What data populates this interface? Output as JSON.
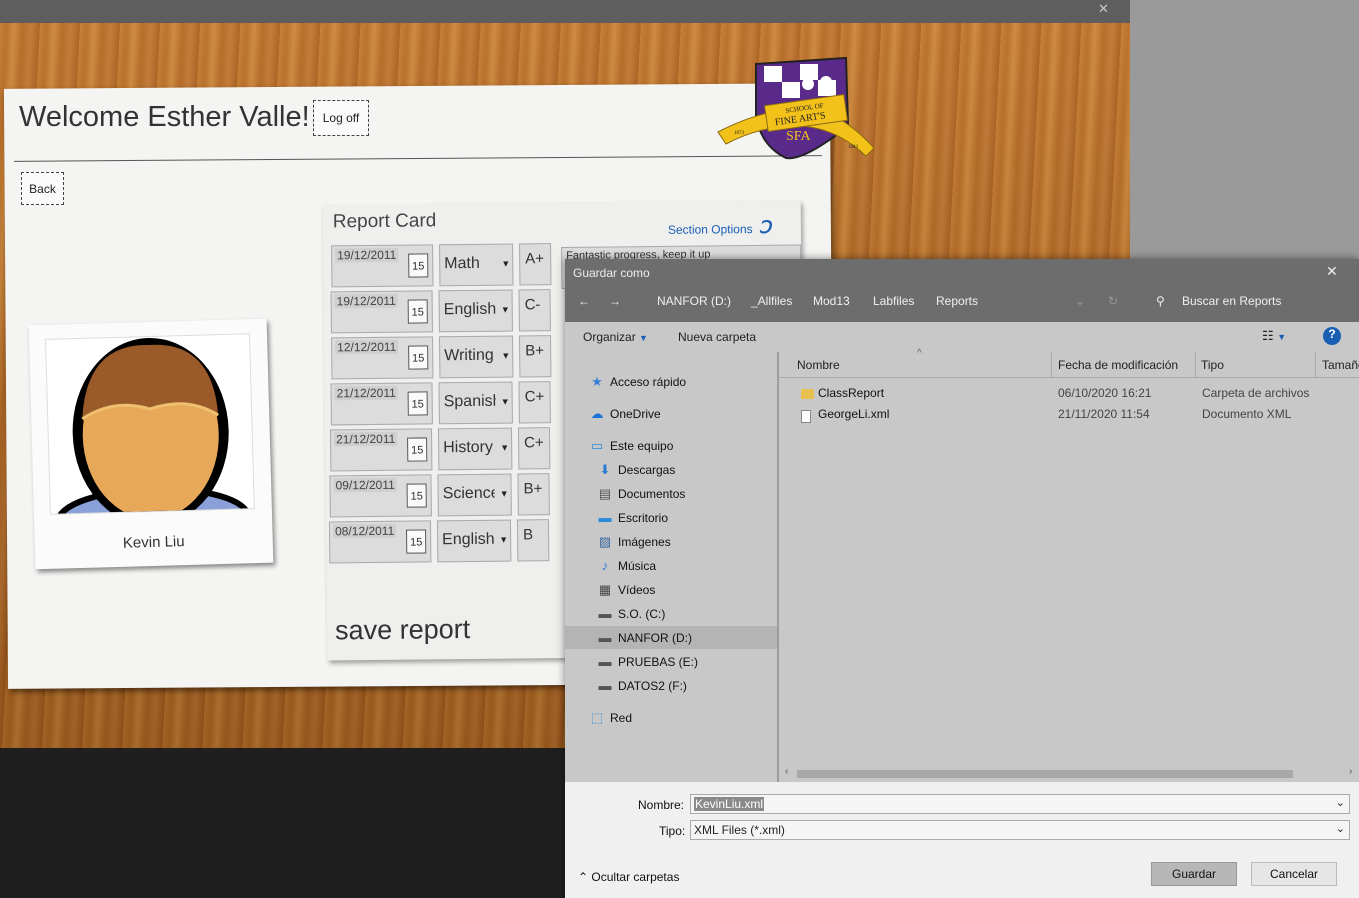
{
  "app": {
    "close_glyph": "✕",
    "welcome": "Welcome Esther Valle!",
    "logoff_label": "Log off",
    "back_label": "Back",
    "crest": {
      "line1": "SCHOOL OF",
      "line2": "FINE ART'S",
      "abbr": "SFA",
      "year_left": "1873",
      "year_right": "1943"
    },
    "student_name": "Kevin Liu",
    "report": {
      "title": "Report Card",
      "section_options": "Section Options",
      "save_label": "save report",
      "comment_snippet": "Fantastic progress, keep it up",
      "rows": [
        {
          "date": "19/12/2011",
          "cal": "15",
          "subject": "Math",
          "grade": "A+"
        },
        {
          "date": "19/12/2011",
          "cal": "15",
          "subject": "English",
          "grade": "C-"
        },
        {
          "date": "12/12/2011",
          "cal": "15",
          "subject": "Writing",
          "grade": "B+"
        },
        {
          "date": "21/12/2011",
          "cal": "15",
          "subject": "Spanish",
          "grade": "C+"
        },
        {
          "date": "21/12/2011",
          "cal": "15",
          "subject": "History",
          "grade": "C+"
        },
        {
          "date": "09/12/2011",
          "cal": "15",
          "subject": "Science",
          "grade": "B+"
        },
        {
          "date": "08/12/2011",
          "cal": "15",
          "subject": "English",
          "grade": "B"
        }
      ]
    }
  },
  "dialog": {
    "title": "Guardar como",
    "close_glyph": "✕",
    "breadcrumb": [
      "NANFOR (D:)",
      "_Allfiles",
      "Mod13",
      "Labfiles",
      "Reports"
    ],
    "search_placeholder": "Buscar en Reports",
    "organize": "Organizar",
    "new_folder": "Nueva carpeta",
    "nav": [
      {
        "label": "Acceso rápido",
        "icon": "star-icon"
      },
      {
        "label": "OneDrive",
        "icon": "cloud-icon"
      },
      {
        "label": "Este equipo",
        "icon": "computer-icon"
      },
      {
        "label": "Descargas",
        "icon": "download-icon"
      },
      {
        "label": "Documentos",
        "icon": "document-icon"
      },
      {
        "label": "Escritorio",
        "icon": "desktop-icon"
      },
      {
        "label": "Imágenes",
        "icon": "image-icon"
      },
      {
        "label": "Música",
        "icon": "music-icon"
      },
      {
        "label": "Vídeos",
        "icon": "video-icon"
      },
      {
        "label": "S.O. (C:)",
        "icon": "drive-icon"
      },
      {
        "label": "NANFOR (D:)",
        "icon": "drive-icon",
        "selected": true
      },
      {
        "label": "PRUEBAS (E:)",
        "icon": "drive-icon"
      },
      {
        "label": "DATOS2 (F:)",
        "icon": "drive-icon"
      },
      {
        "label": "Red",
        "icon": "network-icon"
      }
    ],
    "columns": [
      "Nombre",
      "Fecha de modificación",
      "Tipo",
      "Tamaño"
    ],
    "files": [
      {
        "name": "ClassReport",
        "date": "06/10/2020 16:21",
        "type": "Carpeta de archivos",
        "icon": "folder-icon"
      },
      {
        "name": "GeorgeLi.xml",
        "date": "21/11/2020 11:54",
        "type": "Documento XML",
        "icon": "file-icon"
      }
    ],
    "filename_label": "Nombre:",
    "filename_value": "KevinLiu.xml",
    "type_label": "Tipo:",
    "type_value": "XML Files (*.xml)",
    "hide_folders": "Ocultar carpetas",
    "save_button": "Guardar",
    "cancel_button": "Cancelar"
  }
}
